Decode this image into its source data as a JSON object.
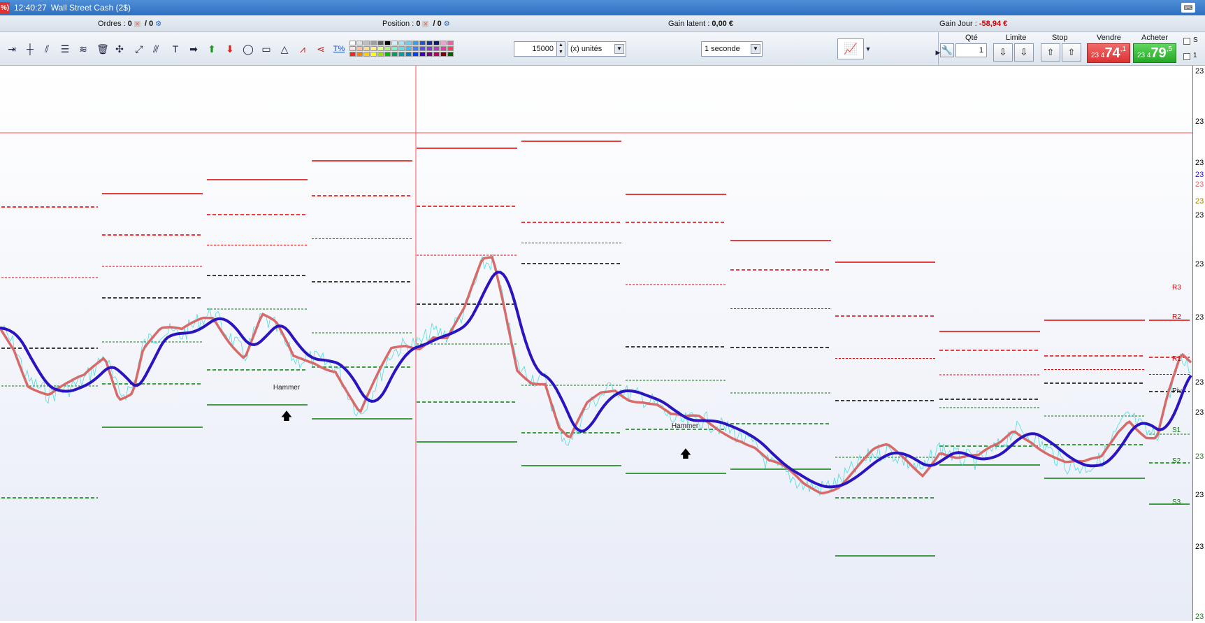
{
  "window": {
    "percent_badge": "%)",
    "clock": "12:40:27",
    "title": "Wall Street Cash (2$)",
    "keyboard_icon": "keyboard-icon"
  },
  "infobar": {
    "ordres_label": "Ordres :",
    "ordres_value": "0",
    "ordres_value2": "/ 0",
    "position_label": "Position :",
    "position_value": "0",
    "position_value2": "/ 0",
    "gain_latent_label": "Gain latent :",
    "gain_latent_value": "0,00 €",
    "gain_jour_label": "Gain Jour :",
    "gain_jour_value": "-58,94 €"
  },
  "toolbar": {
    "quantity": "15000",
    "unit_select": "(x) unités",
    "interval_select": "1 seconde",
    "palette_colors": [
      "#ffffff",
      "#e0e0e0",
      "#c0c0c0",
      "#a0a0a0",
      "#606060",
      "#000000",
      "#d0f0ff",
      "#9fe3ff",
      "#5ad3f7",
      "#33a3e8",
      "#2056c9",
      "#1232a0",
      "#0b1b74",
      "#ff9ad4",
      "#ff55aa",
      "#ffe0e0",
      "#ffc0a0",
      "#ffe080",
      "#fff080",
      "#e0ff80",
      "#b0f080",
      "#80f0c0",
      "#60e0e0",
      "#40c0f0",
      "#4080ff",
      "#6050e0",
      "#8040d0",
      "#b040c0",
      "#e040a0",
      "#ff4060",
      "#ff2020",
      "#ff7f00",
      "#ffd000",
      "#ffff00",
      "#a0e000",
      "#00c000",
      "#00a060",
      "#00a0a0",
      "#0080c0",
      "#0040ff",
      "#4000c0",
      "#800080",
      "#c00060",
      "#800000",
      "#006000"
    ]
  },
  "orders": {
    "qte_label": "Qté",
    "qte_value": "1",
    "limite_label": "Limite",
    "stop_label": "Stop",
    "vendre_label": "Vendre",
    "vendre_prefix": "23 4",
    "vendre_big": "74",
    "vendre_suffix": ",1",
    "acheter_label": "Acheter",
    "acheter_prefix": "23 4",
    "acheter_big": "79",
    "acheter_suffix": ",5",
    "chk1": "S",
    "chk2": "1"
  },
  "chart_data": {
    "type": "line",
    "annotations": [
      {
        "text": "Hammer",
        "at": 3
      },
      {
        "text": "Hammer",
        "at": 7
      }
    ],
    "pivot_labels": [
      "R3",
      "R2",
      "R1",
      "Piv",
      "S1",
      "S2",
      "S3"
    ],
    "axis_ticks": [
      "23",
      "23",
      "23",
      "23",
      "23",
      "23",
      "23",
      "23",
      "23",
      "23",
      "23",
      "23",
      "23",
      "23",
      "23",
      "23",
      "23"
    ],
    "colors": {
      "sma_fast": "#d86a6a",
      "sma_slow": "#2a14c0",
      "price": "#26d6d6",
      "resistance": "#e00000",
      "support": "#0a7a0a",
      "pivot": "#000000",
      "cursor": "#ff5555"
    }
  }
}
